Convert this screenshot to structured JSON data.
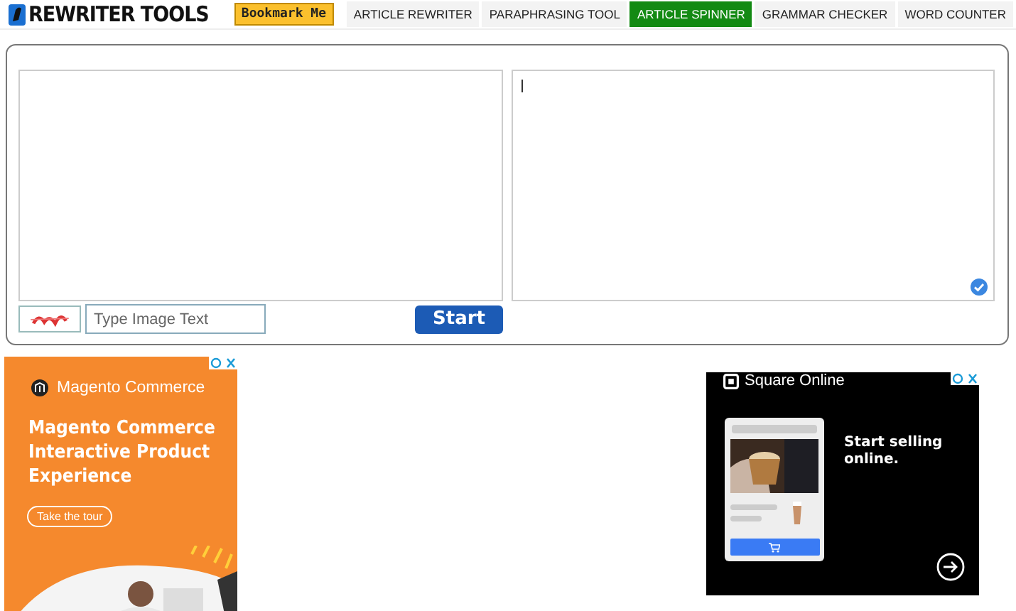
{
  "header": {
    "logo": "REWRITER TOOLS",
    "bookmark_button": "Bookmark Me",
    "nav": [
      {
        "label": "ARTICLE REWRITER",
        "selected": false
      },
      {
        "label": "PARAPHRASING TOOL",
        "selected": false
      },
      {
        "label": "ARTICLE SPINNER",
        "selected": true
      },
      {
        "label": "GRAMMAR CHECKER",
        "selected": false
      },
      {
        "label": "WORD COUNTER",
        "selected": false
      }
    ]
  },
  "spinner": {
    "captcha": {
      "placeholder": "Type Image Text"
    },
    "start_button": "Start"
  },
  "ads": [
    {
      "kind": "magento",
      "brand": "Magento Commerce",
      "headline": "Magento Commerce Interactive Product Experience",
      "cta": "Take the tour"
    },
    {
      "kind": "square",
      "brand": "Square Online",
      "headline": "Start selling online."
    }
  ]
}
